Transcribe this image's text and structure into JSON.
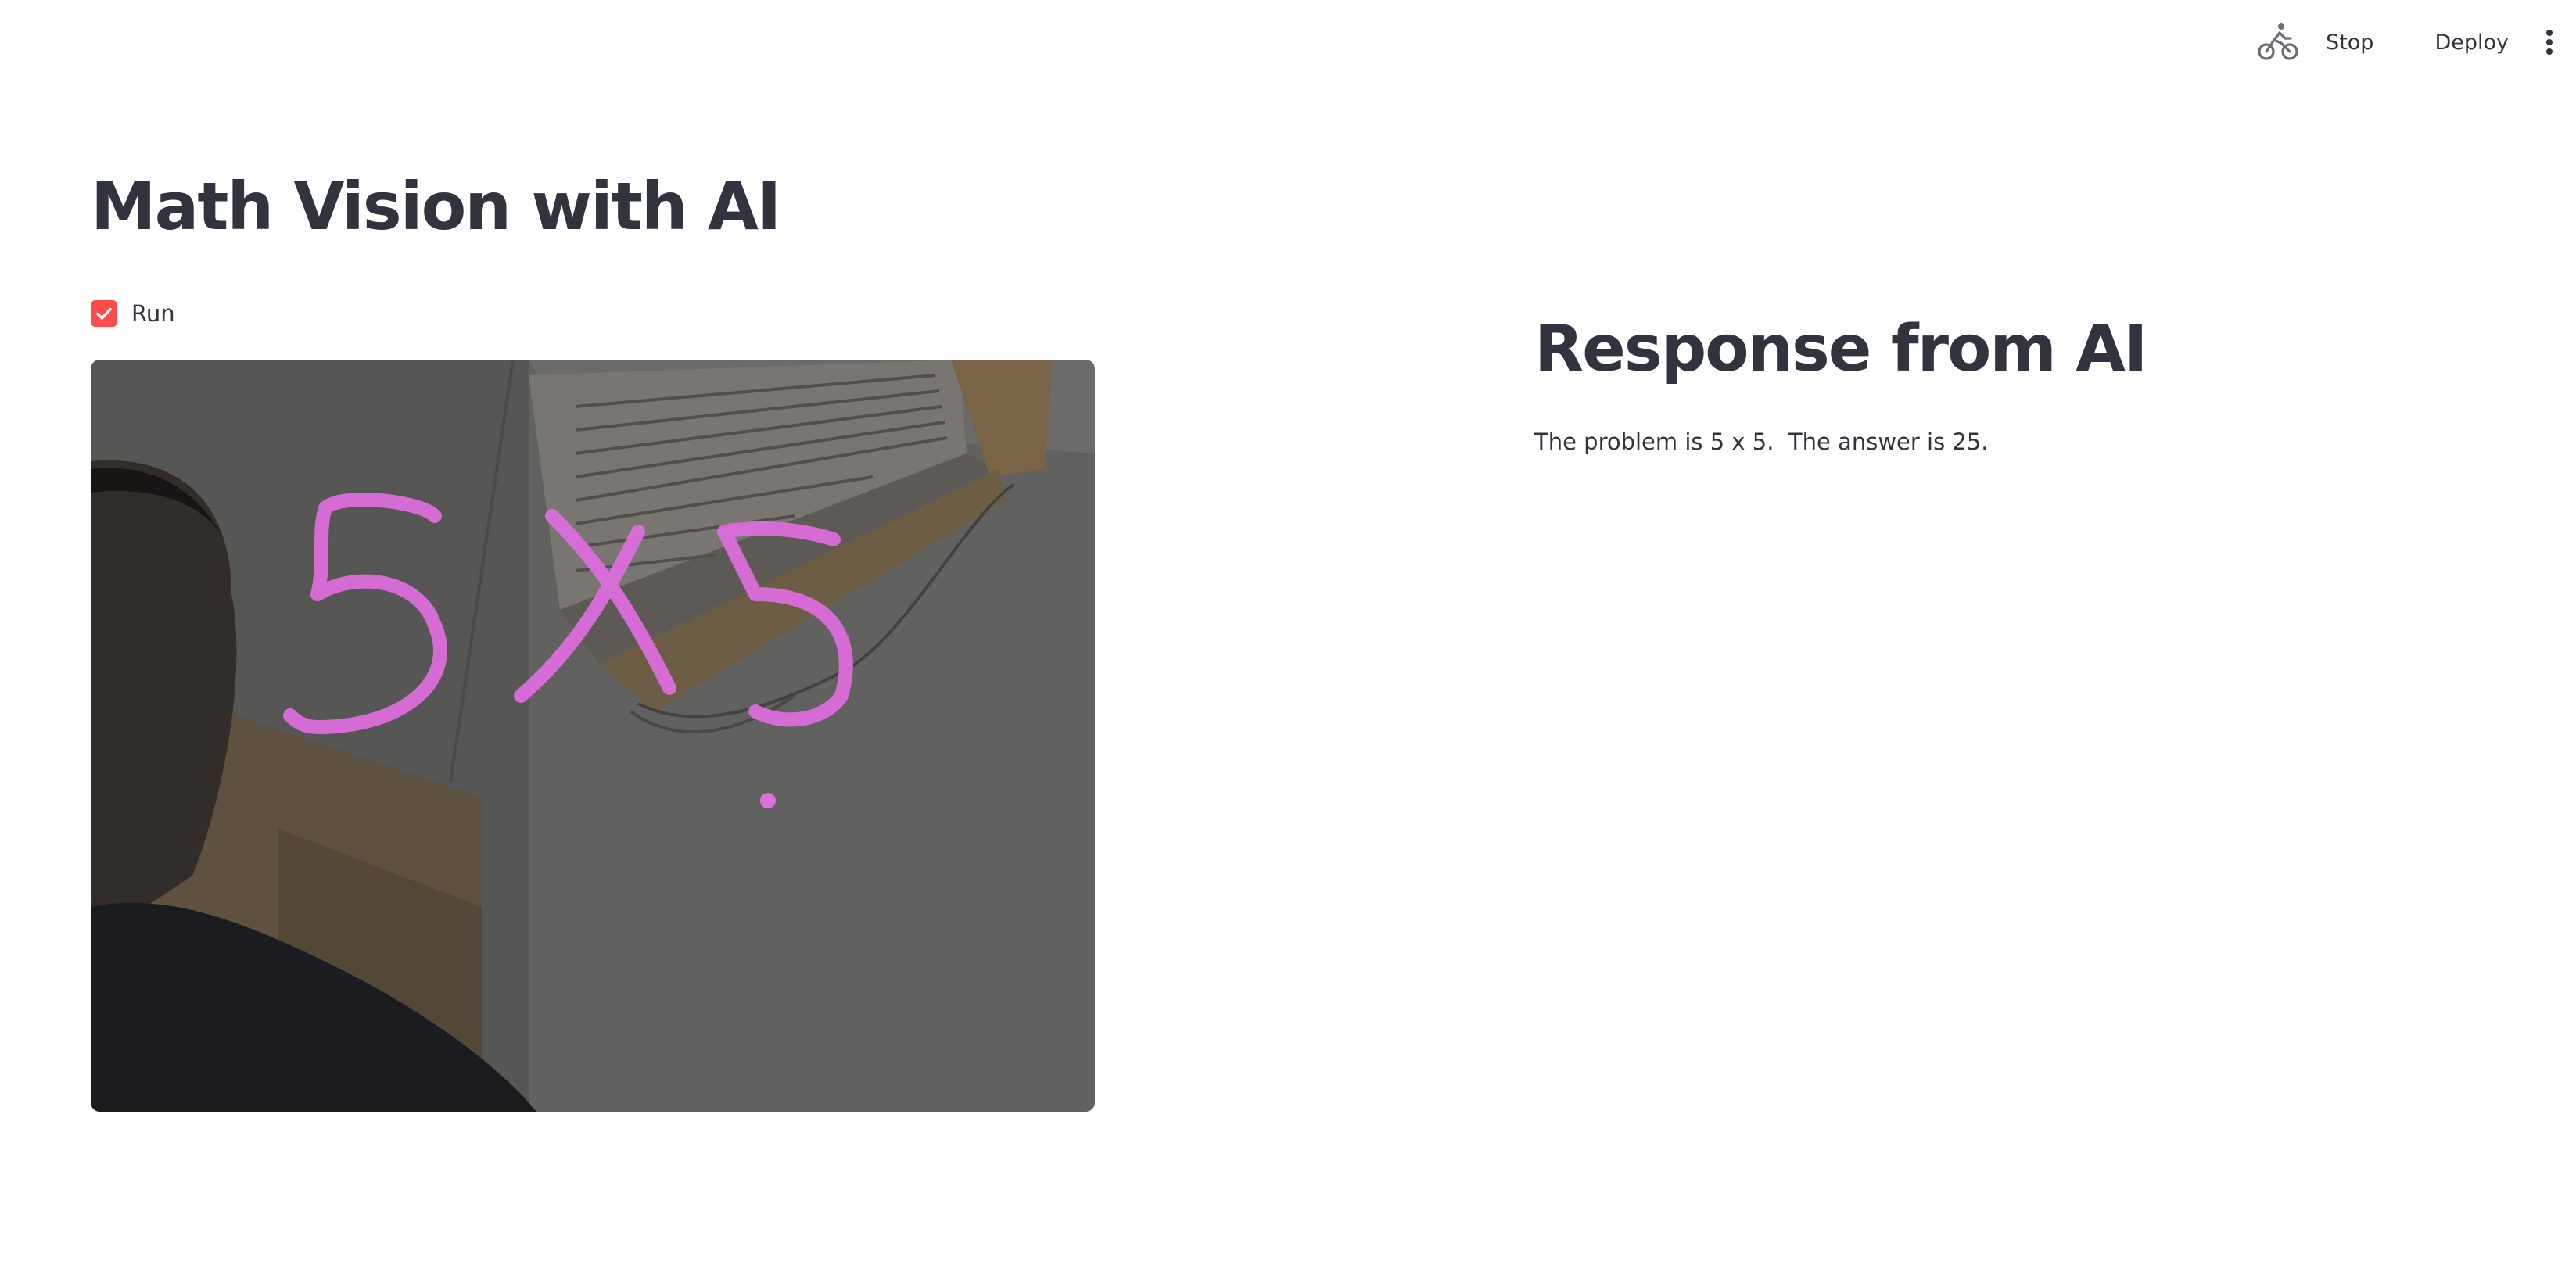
{
  "toolbar": {
    "running_icon": "cyclist-running-icon",
    "stop_label": "Stop",
    "deploy_label": "Deploy",
    "menu_icon": "vertical-ellipsis-icon"
  },
  "main": {
    "title": "Math Vision with AI",
    "run_checkbox": {
      "label": "Run",
      "checked": true,
      "color": "#ff4b4b"
    },
    "camera_feed": {
      "handwritten_text": "5 X 5",
      "ink_color": "#e06ee0"
    }
  },
  "response": {
    "title": "Response from AI",
    "text": "The problem is 5 x 5.  The answer is 25."
  },
  "colors": {
    "text": "#31333f",
    "accent": "#ff4b4b",
    "background": "#ffffff"
  }
}
